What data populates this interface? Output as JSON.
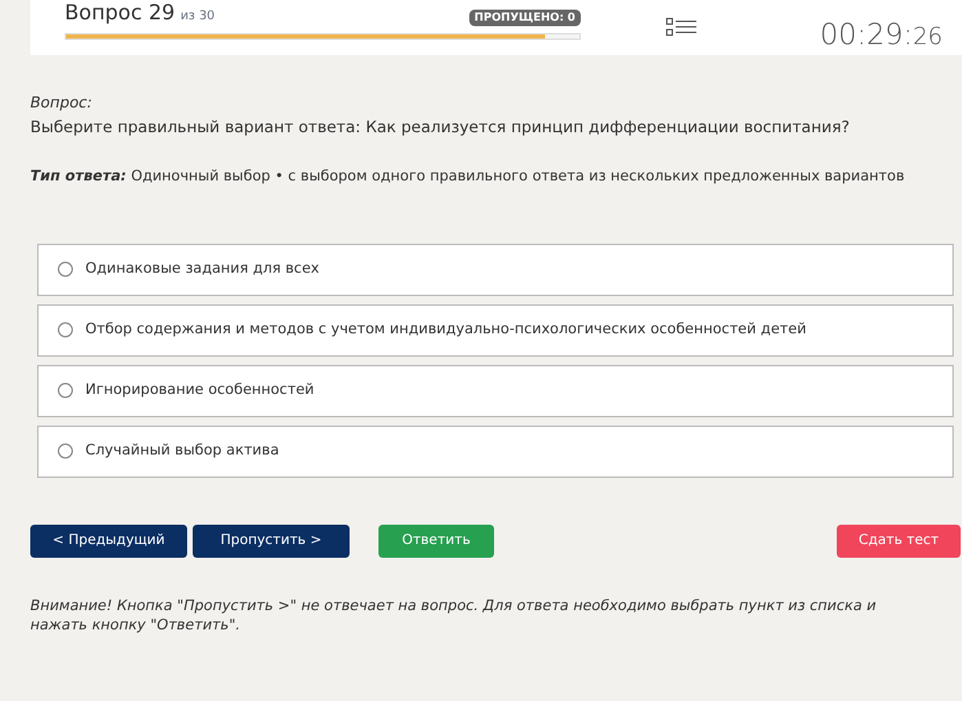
{
  "header": {
    "question_label": "Вопрос 29",
    "question_total": "из 30",
    "skipped_badge": "ПРОПУЩЕНО: 0",
    "progress": {
      "level": 0.933
    },
    "timer_main": "00:29:",
    "timer_seconds": "26"
  },
  "question": {
    "label": "Вопрос:",
    "text": "Выберите правильный вариант ответа: Как реализуется принцип дифференциации воспитания?"
  },
  "answer_type": {
    "label": "Тип ответа:",
    "text": "Одиночный выбор • с выбором одного правильного ответа из нескольких предложенных вариантов"
  },
  "options": [
    {
      "text": "Одинаковые задания для всех",
      "selected": false
    },
    {
      "text": "Отбор содержания и методов с учетом индивидуально-психологических особенностей детей",
      "selected": false
    },
    {
      "text": "Игнорирование особенностей",
      "selected": false
    },
    {
      "text": "Случайный выбор актива",
      "selected": false
    }
  ],
  "buttons": [
    {
      "label": "< Предыдущий",
      "kind": "nav"
    },
    {
      "label": "Пропустить >",
      "kind": "nav"
    },
    {
      "label": "Ответить",
      "kind": "answer"
    },
    {
      "label": "Сдать тест",
      "kind": "finish"
    }
  ],
  "note": "Внимание! Кнопка \"Пропустить >\" не отвечает на вопрос. Для ответа необходимо выбрать пункт из списка и нажать кнопку \"Ответить\"."
}
